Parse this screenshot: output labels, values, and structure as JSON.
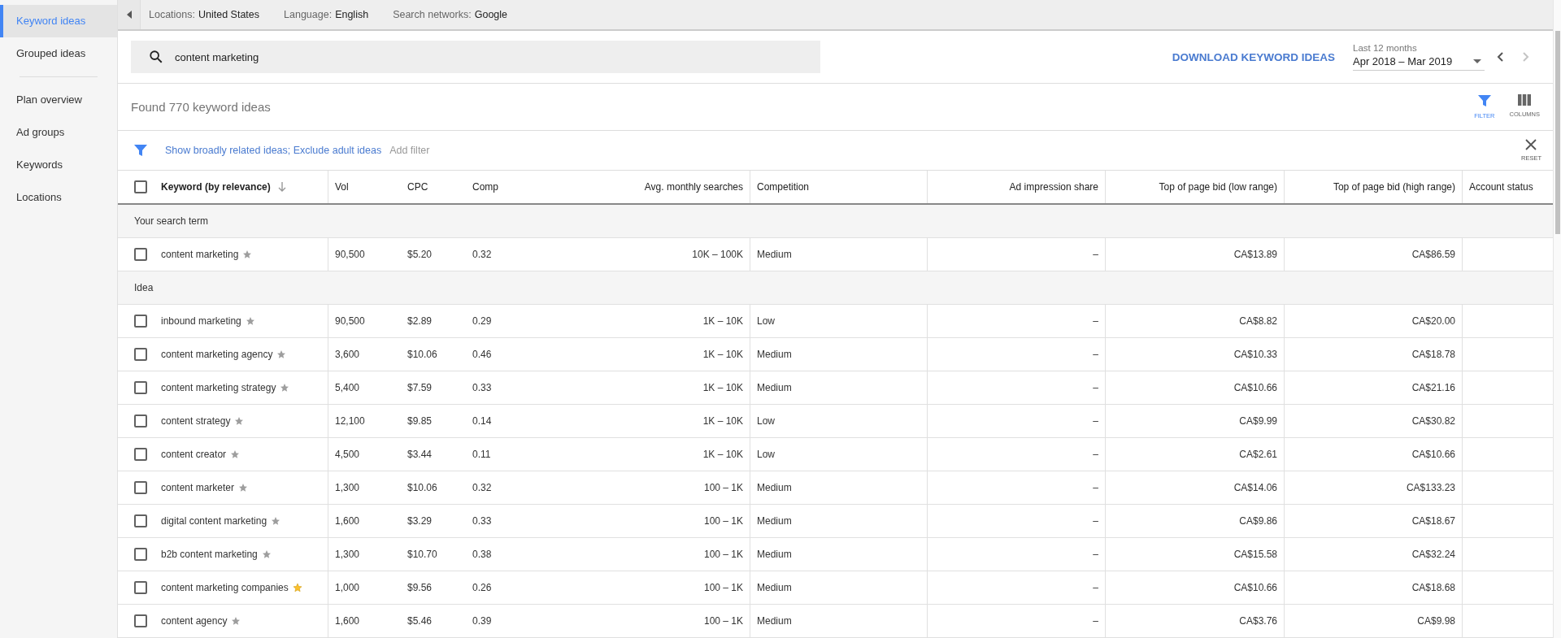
{
  "sidebar": {
    "items": [
      {
        "label": "Keyword ideas",
        "selected": true
      },
      {
        "label": "Grouped ideas",
        "selected": false
      }
    ],
    "items_2": [
      {
        "label": "Plan overview",
        "selected": false
      },
      {
        "label": "Ad groups",
        "selected": false
      },
      {
        "label": "Keywords",
        "selected": false
      },
      {
        "label": "Locations",
        "selected": false
      }
    ]
  },
  "targeting_bar": [
    {
      "label": "Locations:",
      "value": "United States"
    },
    {
      "label": "Language:",
      "value": "English"
    },
    {
      "label": "Search networks:",
      "value": "Google"
    }
  ],
  "search": {
    "value": "content marketing"
  },
  "download_link": "DOWNLOAD KEYWORD IDEAS",
  "date_range": {
    "label": "Last 12 months",
    "value": "Apr 2018 – Mar 2019",
    "next_disabled": true
  },
  "results_count": "Found 770 keyword ideas",
  "toolbar": [
    {
      "kind": "filter",
      "label": "FILTER",
      "active": true
    },
    {
      "kind": "columns",
      "label": "COLUMNS",
      "active": false
    }
  ],
  "filter_bar": {
    "filters": "Show broadly related ideas; Exclude adult ideas",
    "add_filter": "Add filter",
    "reset": "RESET"
  },
  "table": {
    "select_all_checked": false,
    "columns": [
      {
        "label": "Keyword (by relevance)",
        "sorted": true
      },
      {
        "label": "Vol",
        "sorted": false
      },
      {
        "label": "CPC",
        "sorted": false
      },
      {
        "label": "Comp",
        "sorted": false
      },
      {
        "label": "Avg. monthly searches",
        "sorted": false
      },
      {
        "label": "Competition",
        "sorted": false
      },
      {
        "label": "Ad impression share",
        "sorted": false
      },
      {
        "label": "Top of page bid (low range)",
        "sorted": false
      },
      {
        "label": "Top of page bid (high range)",
        "sorted": false
      },
      {
        "label": "Account status",
        "sorted": false
      }
    ],
    "groups": [
      {
        "title": "Your search term",
        "rows": [
          {
            "checked": false,
            "starred": false,
            "cells": [
              "content marketing",
              "90,500",
              "$5.20",
              "0.32",
              "10K – 100K",
              "Medium",
              "–",
              "CA$13.89",
              "CA$86.59"
            ]
          }
        ]
      },
      {
        "title": "Idea",
        "rows": [
          {
            "checked": false,
            "starred": false,
            "cells": [
              "inbound marketing",
              "90,500",
              "$2.89",
              "0.29",
              "1K – 10K",
              "Low",
              "–",
              "CA$8.82",
              "CA$20.00"
            ]
          },
          {
            "checked": false,
            "starred": false,
            "cells": [
              "content marketing agency",
              "3,600",
              "$10.06",
              "0.46",
              "1K – 10K",
              "Medium",
              "–",
              "CA$10.33",
              "CA$18.78"
            ]
          },
          {
            "checked": false,
            "starred": false,
            "cells": [
              "content marketing strategy",
              "5,400",
              "$7.59",
              "0.33",
              "1K – 10K",
              "Medium",
              "–",
              "CA$10.66",
              "CA$21.16"
            ]
          },
          {
            "checked": false,
            "starred": false,
            "cells": [
              "content strategy",
              "12,100",
              "$9.85",
              "0.14",
              "1K – 10K",
              "Low",
              "–",
              "CA$9.99",
              "CA$30.82"
            ]
          },
          {
            "checked": false,
            "starred": false,
            "cells": [
              "content creator",
              "4,500",
              "$3.44",
              "0.11",
              "1K – 10K",
              "Low",
              "–",
              "CA$2.61",
              "CA$10.66"
            ]
          },
          {
            "checked": false,
            "starred": false,
            "cells": [
              "content marketer",
              "1,300",
              "$10.06",
              "0.32",
              "100 – 1K",
              "Medium",
              "–",
              "CA$14.06",
              "CA$133.23"
            ]
          },
          {
            "checked": false,
            "starred": false,
            "cells": [
              "digital content marketing",
              "1,600",
              "$3.29",
              "0.33",
              "100 – 1K",
              "Medium",
              "–",
              "CA$9.86",
              "CA$18.67"
            ]
          },
          {
            "checked": false,
            "starred": false,
            "cells": [
              "b2b content marketing",
              "1,300",
              "$10.70",
              "0.38",
              "100 – 1K",
              "Medium",
              "–",
              "CA$15.58",
              "CA$32.24"
            ]
          },
          {
            "checked": false,
            "starred": true,
            "cells": [
              "content marketing companies",
              "1,000",
              "$9.56",
              "0.26",
              "100 – 1K",
              "Medium",
              "–",
              "CA$10.66",
              "CA$18.68"
            ]
          },
          {
            "checked": false,
            "starred": false,
            "cells": [
              "content agency",
              "1,600",
              "$5.46",
              "0.39",
              "100 – 1K",
              "Medium",
              "–",
              "CA$3.76",
              "CA$9.98"
            ]
          }
        ]
      }
    ]
  }
}
